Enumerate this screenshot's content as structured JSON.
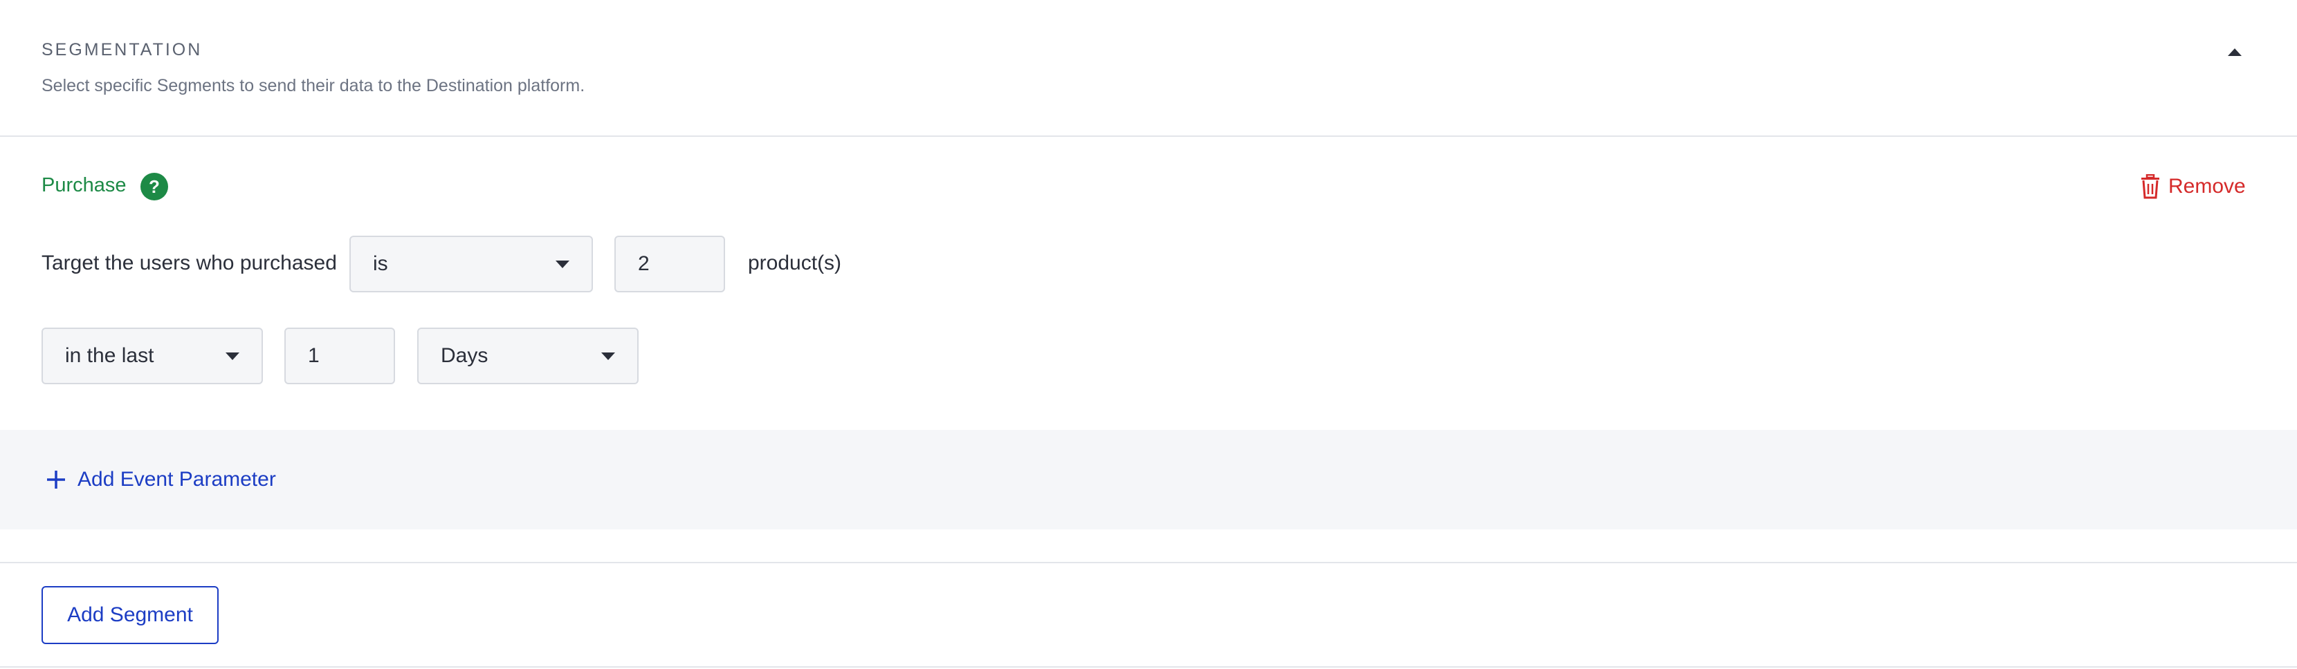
{
  "header": {
    "title": "SEGMENTATION",
    "subtitle": "Select specific Segments to send their data to the Destination platform.",
    "collapse_icon": "chevron-up-icon"
  },
  "segment": {
    "name": "Purchase",
    "help_icon": "question-icon",
    "help_glyph": "?",
    "remove_label": "Remove",
    "remove_icon": "trash-icon",
    "target_label": "Target the users who purchased",
    "operator_value": "is",
    "count_value": "2",
    "count_suffix": "product(s)",
    "time_operator_value": "in the last",
    "time_amount_value": "1",
    "time_unit_value": "Days"
  },
  "event_parameters": {
    "add_label": "Add Event Parameter",
    "add_icon": "plus-icon"
  },
  "footer": {
    "add_segment_label": "Add Segment"
  },
  "colors": {
    "accent": "#1c3dc4",
    "success": "#1d8a46",
    "danger": "#d52a2a"
  }
}
